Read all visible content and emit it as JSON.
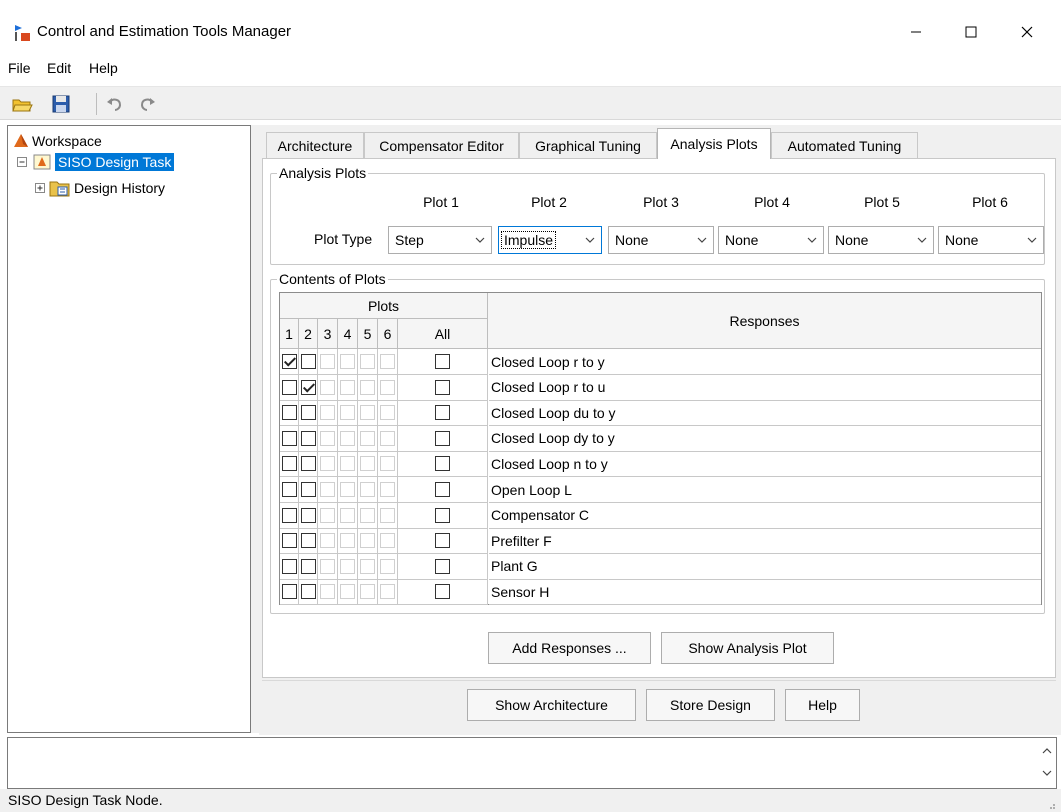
{
  "window": {
    "title": "Control and Estimation Tools Manager",
    "controls": {
      "minimize": "minimize-icon",
      "maximize": "maximize-icon",
      "close": "close-icon"
    }
  },
  "menu": {
    "items": [
      "File",
      "Edit",
      "Help"
    ]
  },
  "toolbar": {
    "icons": [
      "open-folder-icon",
      "save-icon",
      "undo-icon",
      "redo-icon"
    ]
  },
  "tree": {
    "root": "Workspace",
    "task": "SISO Design Task",
    "child": "Design History"
  },
  "tabs": [
    {
      "label": "Architecture",
      "active": false
    },
    {
      "label": "Compensator Editor",
      "active": false
    },
    {
      "label": "Graphical Tuning",
      "active": false
    },
    {
      "label": "Analysis Plots",
      "active": true
    },
    {
      "label": "Automated Tuning",
      "active": false
    }
  ],
  "analysis_plots": {
    "group_title": "Analysis Plots",
    "plot_type_label": "Plot Type",
    "plots": [
      {
        "name": "Plot 1",
        "type": "Step"
      },
      {
        "name": "Plot 2",
        "type": "Impulse"
      },
      {
        "name": "Plot 3",
        "type": "None"
      },
      {
        "name": "Plot 4",
        "type": "None"
      },
      {
        "name": "Plot 5",
        "type": "None"
      },
      {
        "name": "Plot 6",
        "type": "None"
      }
    ]
  },
  "contents": {
    "group_title": "Contents of Plots",
    "plots_header": "Plots",
    "responses_header": "Responses",
    "plot_columns": [
      "1",
      "2",
      "3",
      "4",
      "5",
      "6",
      "All"
    ],
    "rows": [
      {
        "response": "Closed Loop r to y",
        "p1": true,
        "p2": false
      },
      {
        "response": "Closed Loop r to u",
        "p1": false,
        "p2": true
      },
      {
        "response": "Closed Loop du to y",
        "p1": false,
        "p2": false
      },
      {
        "response": "Closed Loop dy to y",
        "p1": false,
        "p2": false
      },
      {
        "response": "Closed Loop n to y",
        "p1": false,
        "p2": false
      },
      {
        "response": "Open Loop L",
        "p1": false,
        "p2": false
      },
      {
        "response": "Compensator C",
        "p1": false,
        "p2": false
      },
      {
        "response": "Prefilter F",
        "p1": false,
        "p2": false
      },
      {
        "response": "Plant G",
        "p1": false,
        "p2": false
      },
      {
        "response": "Sensor H",
        "p1": false,
        "p2": false
      }
    ]
  },
  "buttons": {
    "add_responses": "Add Responses ...",
    "show_analysis_plot": "Show Analysis Plot",
    "show_architecture": "Show Architecture",
    "store_design": "Store Design",
    "help": "Help"
  },
  "status": {
    "text": "SISO Design Task Node."
  }
}
